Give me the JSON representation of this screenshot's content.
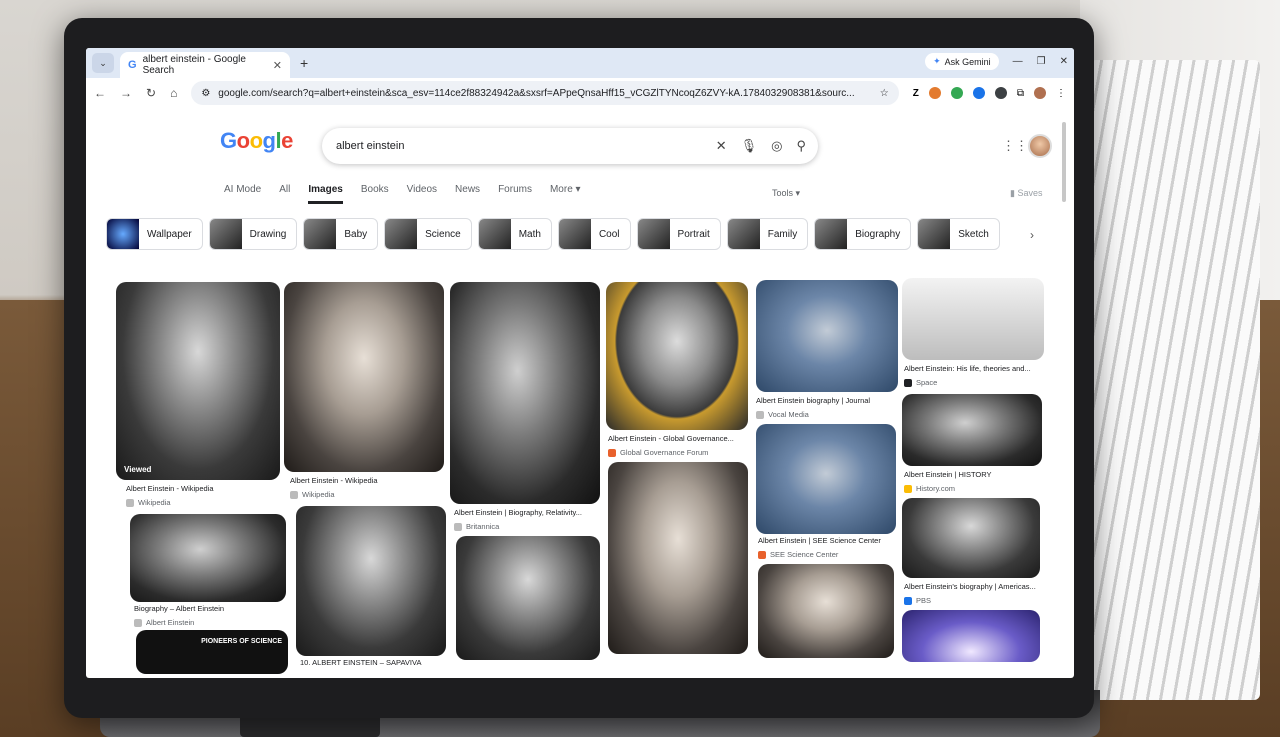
{
  "browser": {
    "tab_title": "albert einstein - Google Search",
    "tab_icon": "G",
    "ask_gemini": "Ask Gemini",
    "url": "google.com/search?q=albert+einstein&sca_esv=114ce2f88324942a&sxsrf=APpeQnsaHff15_vCGZlTYNcoqZ6ZVY-kA.1784032908381&sourc..."
  },
  "google": {
    "search_query": "albert einstein",
    "tabs": [
      "AI Mode",
      "All",
      "Images",
      "Books",
      "Videos",
      "News",
      "Forums",
      "More"
    ],
    "tools": "Tools",
    "saves": "Saves"
  },
  "chips": [
    "Wallpaper",
    "Drawing",
    "Baby",
    "Science",
    "Math",
    "Cool",
    "Portrait",
    "Family",
    "Biography",
    "Sketch"
  ],
  "results": [
    {
      "caption": "Albert Einstein - Wikipedia",
      "source": "Wikipedia",
      "badge": "Viewed"
    },
    {
      "caption": "Biography – Albert Einstein",
      "source": "Albert Einstein"
    },
    {
      "caption": "",
      "source": "",
      "badge": "PIONEERS OF SCIENCE"
    },
    {
      "caption": "Albert Einstein - Wikipedia",
      "source": "Wikipedia"
    },
    {
      "caption": "10. ALBERT EINSTEIN – SAPAVIVA",
      "source": ""
    },
    {
      "caption": "Albert Einstein | Biography, Relativity...",
      "source": "Britannica"
    },
    {
      "caption": "Albert Einstein - Global Governance...",
      "source": "Global Governance Forum"
    },
    {
      "caption": "Albert Einstein biography | Journal",
      "source": "Vocal Media"
    },
    {
      "caption": "Albert Einstein | SEE Science Center",
      "source": "SEE Science Center"
    },
    {
      "caption": "Albert Einstein: His life, theories and...",
      "source": "Space"
    },
    {
      "caption": "Albert Einstein | HISTORY",
      "source": "History.com"
    },
    {
      "caption": "Albert Einstein's biography | Americas...",
      "source": "PBS"
    }
  ]
}
